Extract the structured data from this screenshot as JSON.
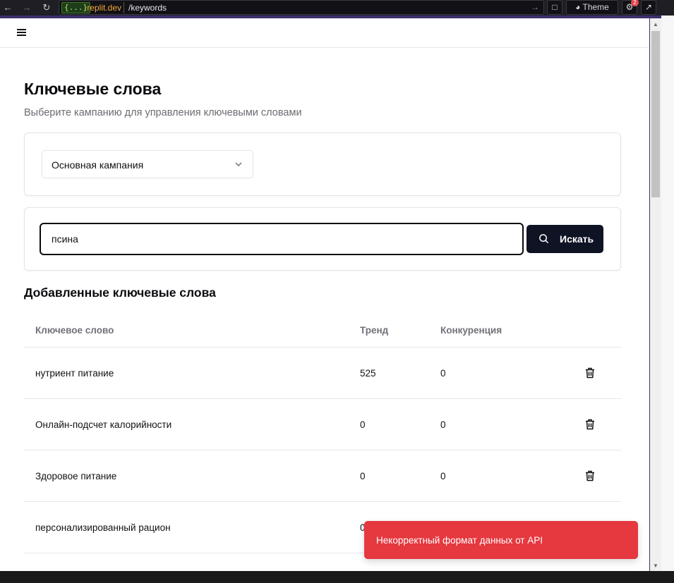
{
  "browser": {
    "domain_badge": "{...}",
    "domain": ".replit.dev",
    "path": "/keywords",
    "theme_label": "Theme",
    "notification_count": "2"
  },
  "page": {
    "title": "Ключевые слова",
    "subtitle": "Выберите кампанию для управления ключевыми словами",
    "campaign_select": {
      "value": "Основная кампания"
    },
    "search": {
      "value": "псина",
      "button_label": "Искать"
    },
    "section_title": "Добавленные ключевые слова",
    "table": {
      "columns": [
        "Ключевое слово",
        "Тренд",
        "Конкуренция"
      ],
      "rows": [
        {
          "keyword": "нутриент питание",
          "trend": "525",
          "competition": "0"
        },
        {
          "keyword": "Онлайн-подсчет калорийности",
          "trend": "0",
          "competition": "0"
        },
        {
          "keyword": "Здоровое питание",
          "trend": "0",
          "competition": "0"
        },
        {
          "keyword": "персонализированный рацион",
          "trend": "0",
          "competition": ""
        }
      ]
    },
    "toast": {
      "message": "Некорректный формат данных от API",
      "color": "#e5383f"
    }
  }
}
